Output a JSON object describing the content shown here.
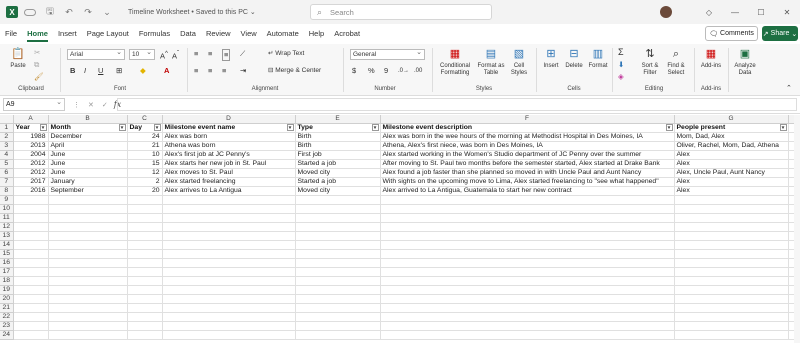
{
  "titlebar": {
    "doc_title": "Timeline Worksheet • Saved to this PC ⌄",
    "search_placeholder": "Search"
  },
  "tabs": [
    "File",
    "Home",
    "Insert",
    "Page Layout",
    "Formulas",
    "Data",
    "Review",
    "View",
    "Automate",
    "Help",
    "Acrobat"
  ],
  "actions": {
    "comments": "Comments",
    "share": "Share"
  },
  "ribbon": {
    "clipboard": {
      "paste": "Paste",
      "label": "Clipboard"
    },
    "font": {
      "name": "Arial",
      "size": "10",
      "label": "Font",
      "bold": "B",
      "italic": "I",
      "underline": "U"
    },
    "alignment": {
      "wrap": "Wrap Text",
      "merge": "Merge & Center",
      "label": "Alignment"
    },
    "number": {
      "format": "General",
      "label": "Number",
      "currency": "$",
      "percent": "%",
      "comma": "9"
    },
    "styles": {
      "conditional": "Conditional Formatting",
      "format_table": "Format as Table",
      "cell_styles": "Cell Styles",
      "label": "Styles"
    },
    "cells": {
      "insert": "Insert",
      "delete": "Delete",
      "format": "Format",
      "label": "Cells"
    },
    "editing": {
      "sort": "Sort & Filter",
      "find": "Find & Select",
      "label": "Editing"
    },
    "addins": {
      "addins": "Add-ins",
      "label": "Add-ins"
    },
    "analyze": {
      "label": "Analyze Data"
    }
  },
  "formula_bar": {
    "name_box": "A9",
    "fx": "fx"
  },
  "columns": [
    "A",
    "B",
    "C",
    "D",
    "E",
    "F",
    "G"
  ],
  "row_numbers": [
    "1",
    "2",
    "3",
    "4",
    "5",
    "6",
    "7",
    "8",
    "9",
    "10",
    "11",
    "12",
    "13",
    "14",
    "15",
    "16",
    "17",
    "18",
    "19",
    "20",
    "21",
    "22",
    "23",
    "24"
  ],
  "headers": [
    "Year",
    "Month",
    "Day",
    "Milestone event name",
    "Type",
    "Milestone event description",
    "People present"
  ],
  "rows": [
    [
      "1988",
      "December",
      "24",
      "Alex was born",
      "Birth",
      "Alex was born in the wee hours of the morning at Methodist Hospital in Des Moines, IA",
      "Mom, Dad, Alex"
    ],
    [
      "2013",
      "April",
      "21",
      "Athena was born",
      "Birth",
      "Athena, Alex's first niece, was born in Des Moines, IA",
      "Oliver, Rachel, Mom, Dad, Athena"
    ],
    [
      "2004",
      "June",
      "10",
      "Alex's first job at JC Penny's",
      "First job",
      "Alex started working in the Women's Studio department of JC Penny over the summer",
      "Alex"
    ],
    [
      "2012",
      "June",
      "15",
      "Alex starts her new job in St. Paul",
      "Started a job",
      "After moving to St. Paul two months before the semester started, Alex started at Drake Bank",
      "Alex"
    ],
    [
      "2012",
      "June",
      "12",
      "Alex moves to St. Paul",
      "Moved city",
      "Alex found a job faster than she planned so moved in with Uncle Paul and Aunt Nancy",
      "Alex, Uncle Paul, Aunt Nancy"
    ],
    [
      "2017",
      "January",
      "2",
      "Alex started freelancing",
      "Started a job",
      "With sights on the upcoming move to Lima, Alex started freelancing to \"see what happened\"",
      "Alex"
    ],
    [
      "2016",
      "September",
      "20",
      "Alex arrives to La Antigua",
      "Moved city",
      "Alex arrived to La Antigua, Guatemala to start her new contract",
      "Alex"
    ]
  ],
  "colors": {
    "accent": "#1d6f42",
    "ribbon_bg": "#f7f7f7",
    "header_bg": "#f3f3f3"
  }
}
